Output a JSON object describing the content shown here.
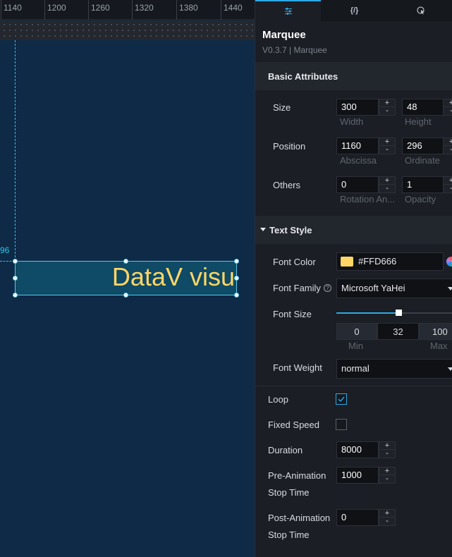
{
  "ruler": {
    "labels": [
      "1140",
      "1200",
      "1260",
      "1320",
      "1380",
      "1440"
    ]
  },
  "canvas": {
    "guide_label": "96",
    "marquee_text": "DataV visu",
    "text_color": "#FFD666",
    "box_color": "#0F4A66",
    "guide_color": "#2EC4E6"
  },
  "tabs": [
    {
      "icon": "sliders-icon",
      "label": "☰"
    },
    {
      "icon": "code-icon",
      "label": "{/}"
    },
    {
      "icon": "interaction-icon",
      "label": "◔"
    }
  ],
  "component": {
    "title": "Marquee",
    "subtitle": "V0.3.7 | Marquee"
  },
  "basic": {
    "title": "Basic Attributes",
    "size_label": "Size",
    "width_value": "300",
    "width_label": "Width",
    "height_value": "48",
    "height_label": "Height",
    "position_label": "Position",
    "x_value": "1160",
    "x_label": "Abscissa",
    "y_value": "296",
    "y_label": "Ordinate",
    "others_label": "Others",
    "rotation_value": "0",
    "rotation_label": "Rotation An...",
    "opacity_value": "1",
    "opacity_label": "Opacity",
    "plus": "+",
    "minus": "-"
  },
  "text_style": {
    "title": "Text Style",
    "font_color_label": "Font Color",
    "font_color_value": "#FFD666",
    "font_family_label": "Font Family",
    "font_family_value": "Microsoft YaHei",
    "font_size_label": "Font Size",
    "font_size_min": "0",
    "font_size_value": "32",
    "font_size_max": "100",
    "min_label": "Min",
    "max_label": "Max",
    "font_size_fraction": 0.32,
    "font_weight_label": "Font Weight",
    "font_weight_value": "normal"
  },
  "animation": {
    "loop_label": "Loop",
    "loop_checked": true,
    "fixed_speed_label": "Fixed Speed",
    "fixed_speed_checked": false,
    "duration_label": "Duration",
    "duration_value": "8000",
    "pre_label_1": "Pre-Animation",
    "pre_label_2": "Stop Time",
    "pre_value": "1000",
    "post_label_1": "Post-Animation",
    "post_label_2": "Stop Time",
    "post_value": "0"
  },
  "colors": {
    "accent": "#2EA8E6",
    "panel_bg": "#1B1E24",
    "canvas_bg": "#0E2A47"
  }
}
